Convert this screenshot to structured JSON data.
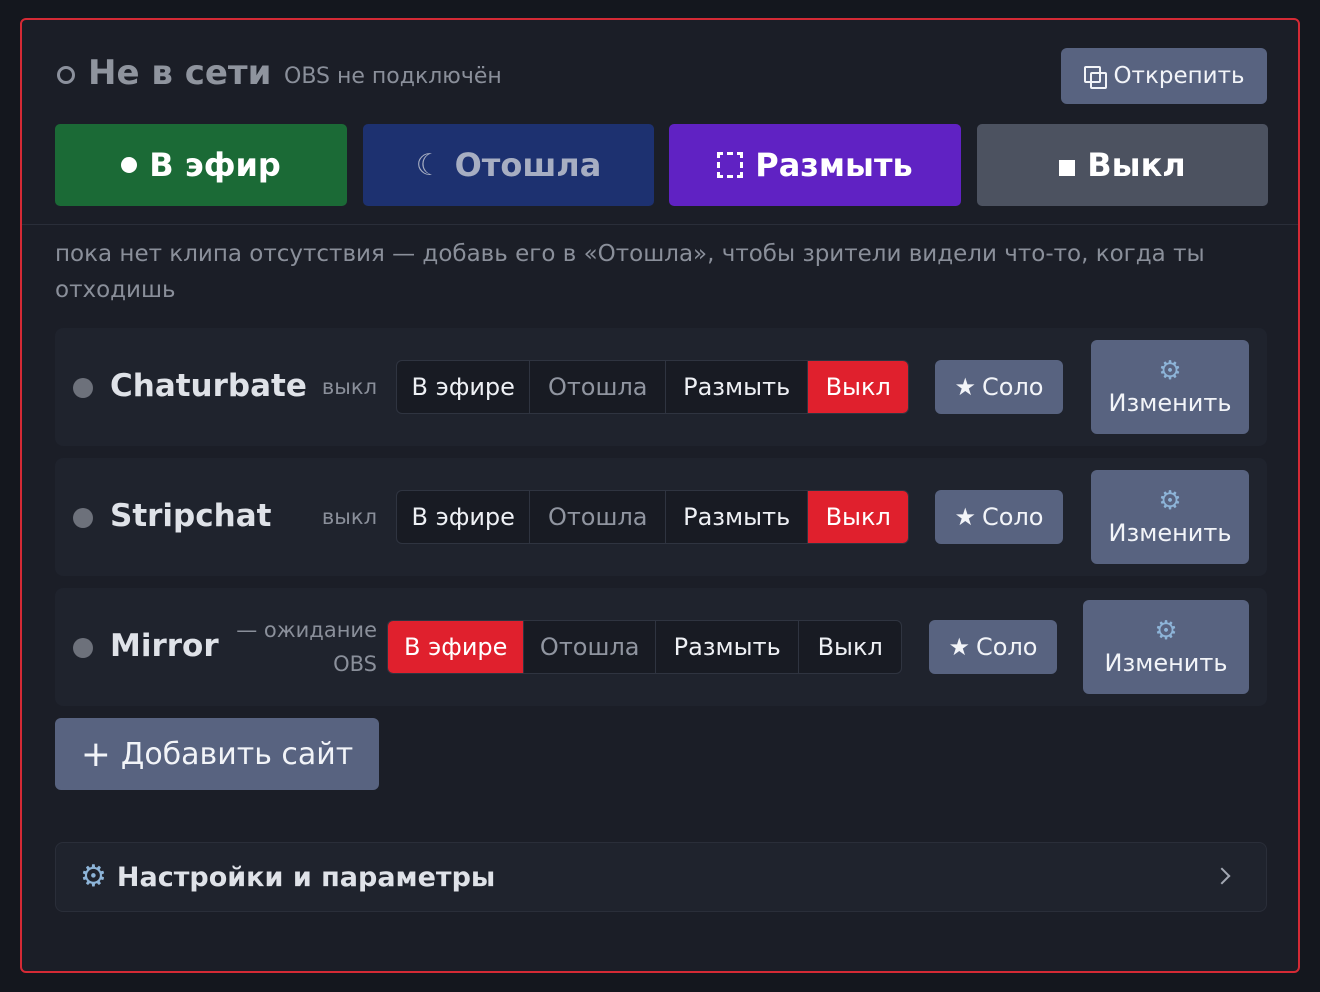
{
  "header": {
    "status_title": "Не в сети",
    "status_subtitle": "OBS не подключён",
    "detach_label": "Открепить"
  },
  "modes": {
    "live": "В эфир",
    "away": "Отошла",
    "blur": "Размыть",
    "off": "Выкл"
  },
  "hint": "пока нет клипа отсутствия — добавь его в «Отошла», чтобы зрители видели что-то, когда ты отходишь",
  "sites": [
    {
      "name": "Chaturbate",
      "state": "выкл",
      "segments": [
        "В эфире",
        "Отошла",
        "Размыть",
        "Выкл"
      ],
      "active_segment": "Выкл",
      "solo_label": "Соло",
      "edit_label": "Изменить"
    },
    {
      "name": "Stripchat",
      "state": "выкл",
      "segments": [
        "В эфире",
        "Отошла",
        "Размыть",
        "Выкл"
      ],
      "active_segment": "Выкл",
      "solo_label": "Соло",
      "edit_label": "Изменить"
    },
    {
      "name": "Mirror",
      "state": "— ожидание OBS",
      "segments": [
        "В эфире",
        "Отошла",
        "Размыть",
        "Выкл"
      ],
      "active_segment": "В эфире",
      "solo_label": "Соло",
      "edit_label": "Изменить"
    }
  ],
  "add_site_label": "Добавить сайт",
  "settings_label": "Настройки и параметры",
  "colors": {
    "border_accent": "#d42a35",
    "live_green": "#1b6a36",
    "away_navy": "#1d3170",
    "blur_purple": "#6022c3",
    "active_red": "#e0202d",
    "button_slate": "#586380"
  },
  "icons": {
    "status": "offline-ring-icon",
    "detach": "detach-window-icon",
    "live": "dot-icon",
    "away": "moon-icon",
    "blur": "dashed-square-icon",
    "off": "stop-square-icon",
    "solo": "star-icon",
    "edit": "gear-icon",
    "add": "plus-icon",
    "settings": "gear-icon",
    "expand": "chevron-right-icon"
  }
}
